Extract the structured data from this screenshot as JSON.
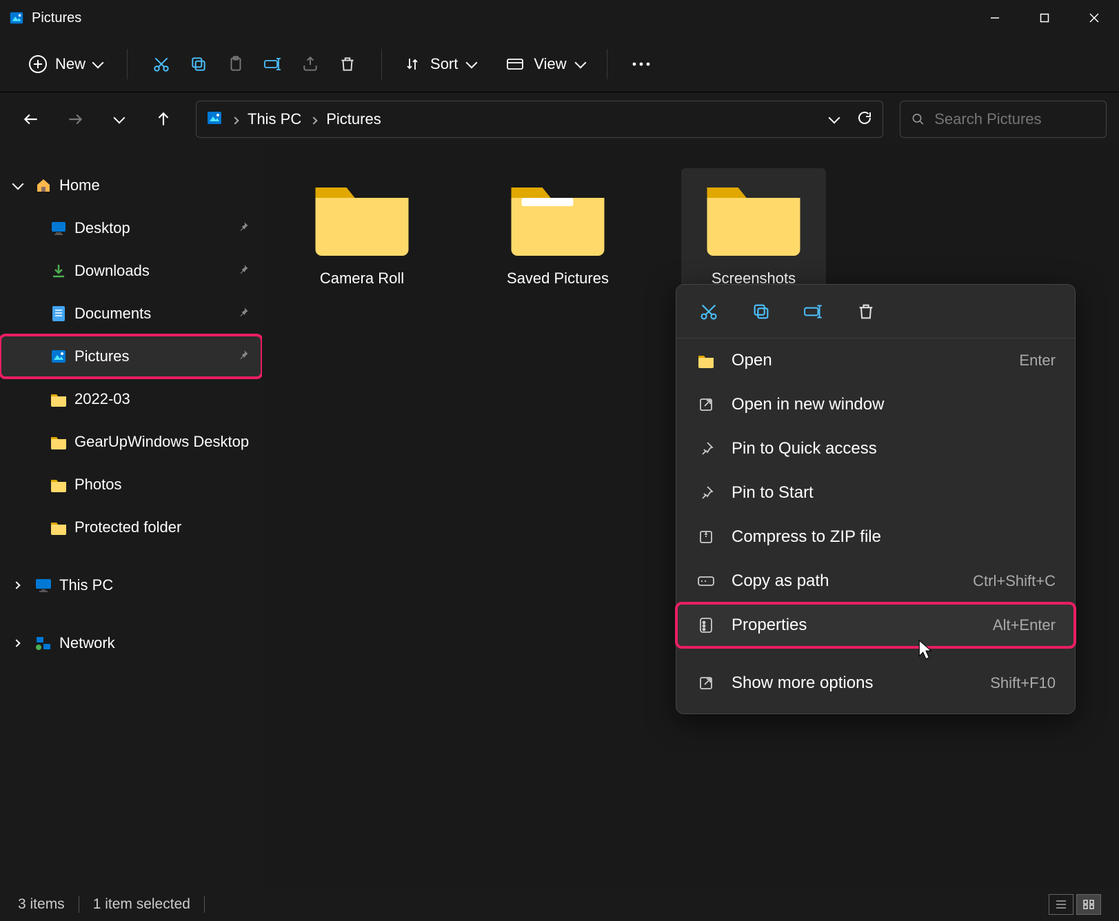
{
  "window": {
    "title": "Pictures",
    "icon": "pictures-app-icon"
  },
  "toolbar": {
    "new_label": "New",
    "sort_label": "Sort",
    "view_label": "View"
  },
  "breadcrumb": {
    "items": [
      "This PC",
      "Pictures"
    ]
  },
  "search": {
    "placeholder": "Search Pictures"
  },
  "sidebar": {
    "items": [
      {
        "label": "Home",
        "icon": "home",
        "expandable": true,
        "expanded": true,
        "level": 0
      },
      {
        "label": "Desktop",
        "icon": "desktop",
        "pinned": true,
        "level": 1
      },
      {
        "label": "Downloads",
        "icon": "downloads",
        "pinned": true,
        "level": 1
      },
      {
        "label": "Documents",
        "icon": "documents",
        "pinned": true,
        "level": 1
      },
      {
        "label": "Pictures",
        "icon": "pictures",
        "pinned": true,
        "level": 1,
        "selected": true,
        "highlight": true
      },
      {
        "label": "2022-03",
        "icon": "folder",
        "level": 1
      },
      {
        "label": "GearUpWindows Desktop",
        "icon": "folder",
        "level": 1
      },
      {
        "label": "Photos",
        "icon": "folder",
        "level": 1
      },
      {
        "label": "Protected folder",
        "icon": "folder",
        "level": 1
      },
      {
        "label": "This PC",
        "icon": "pc",
        "expandable": true,
        "expanded": false,
        "level": 0
      },
      {
        "label": "Network",
        "icon": "network",
        "expandable": true,
        "expanded": false,
        "level": 0
      }
    ]
  },
  "folders": [
    {
      "label": "Camera Roll",
      "selected": false
    },
    {
      "label": "Saved Pictures",
      "selected": false,
      "variant": "open"
    },
    {
      "label": "Screenshots",
      "selected": true
    }
  ],
  "context_menu": {
    "items": [
      {
        "label": "Open",
        "icon": "folder-open",
        "shortcut": "Enter"
      },
      {
        "label": "Open in new window",
        "icon": "external",
        "shortcut": ""
      },
      {
        "label": "Pin to Quick access",
        "icon": "pin",
        "shortcut": ""
      },
      {
        "label": "Pin to Start",
        "icon": "pin",
        "shortcut": ""
      },
      {
        "label": "Compress to ZIP file",
        "icon": "zip",
        "shortcut": ""
      },
      {
        "label": "Copy as path",
        "icon": "path",
        "shortcut": "Ctrl+Shift+C"
      },
      {
        "label": "Properties",
        "icon": "properties",
        "shortcut": "Alt+Enter",
        "highlight": true
      },
      {
        "label": "Show more options",
        "icon": "more",
        "shortcut": "Shift+F10",
        "gap_before": true
      }
    ]
  },
  "statusbar": {
    "item_count": "3 items",
    "selection": "1 item selected"
  },
  "colors": {
    "accent_blue": "#4cc2ff",
    "folder_yellow": "#ffd96a",
    "folder_yellow_dark": "#e0a800",
    "highlight": "#e91e63"
  }
}
